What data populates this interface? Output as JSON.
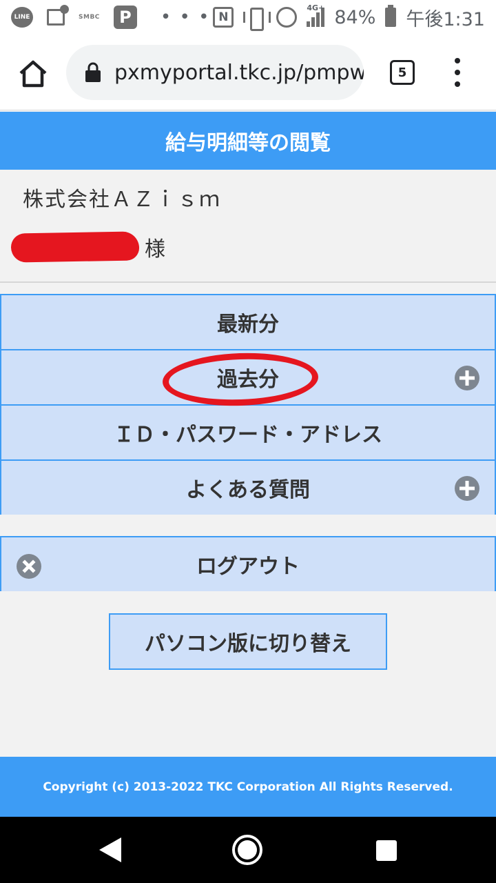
{
  "status_bar": {
    "line_label": "LINE",
    "smbc_label": "SMBC",
    "p_label": "P",
    "more_dots": "• • •",
    "nfc_label": "N",
    "network": "4G+",
    "battery": "84%",
    "time": "午後1:31"
  },
  "browser": {
    "url": "pxmyportal.tkc.jp/pmpw",
    "tab_count": "5"
  },
  "page": {
    "header_title": "給与明細等の閲覧",
    "company_name": "株式会社ＡＺｉｓｍ",
    "honorific": "様",
    "menu": [
      {
        "label": "最新分"
      },
      {
        "label": "過去分"
      },
      {
        "label": "ＩＤ・パスワード・アドレス"
      },
      {
        "label": "よくある質問"
      }
    ],
    "logout_label": "ログアウト",
    "pc_switch_label": "パソコン版に切り替え",
    "footer": "Copyright (c) 2013-2022 TKC Corporation All Rights Reserved."
  },
  "colors": {
    "accent": "#3d9cf5",
    "menu_bg": "#cfe0f9",
    "annotation": "#e5161f",
    "icon_gray": "#7e8690"
  }
}
